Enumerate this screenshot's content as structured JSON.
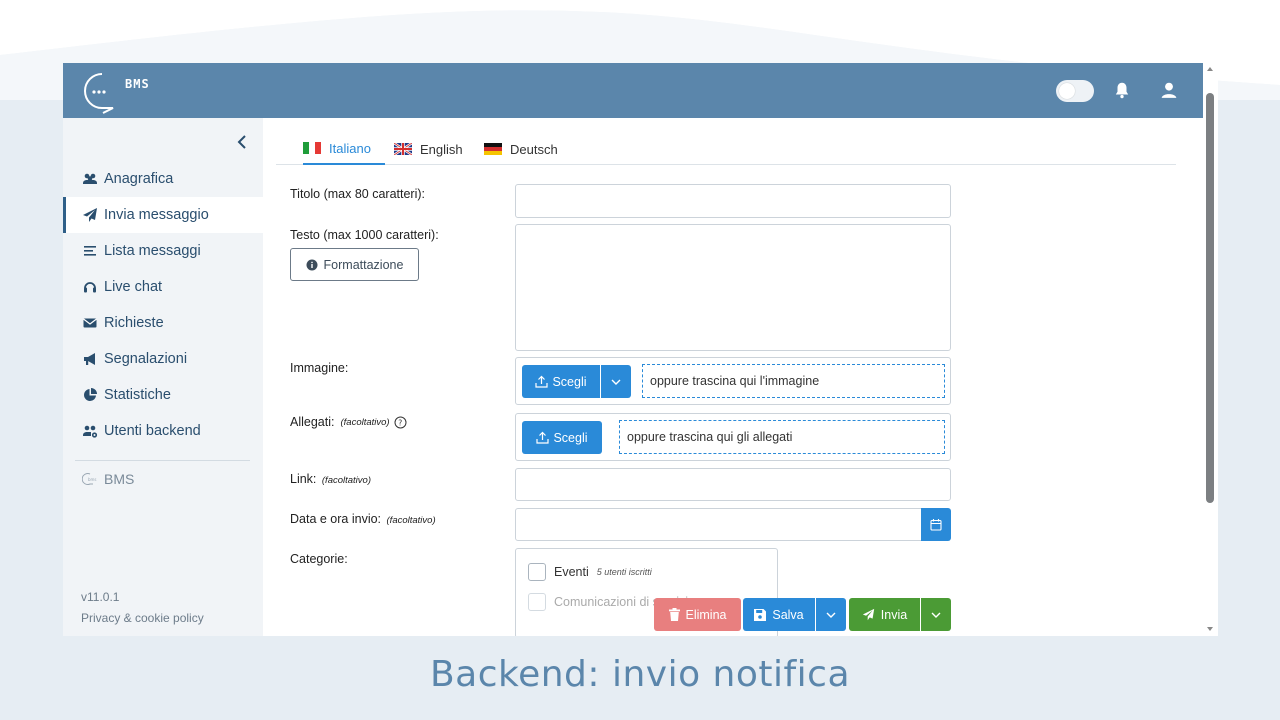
{
  "brand": {
    "logo_text": "BMS"
  },
  "sidebar": {
    "items": [
      {
        "label": "Anagrafica",
        "icon": "users-icon",
        "active": false
      },
      {
        "label": "Invia messaggio",
        "icon": "paper-plane-icon",
        "active": true
      },
      {
        "label": "Lista messaggi",
        "icon": "list-icon",
        "active": false
      },
      {
        "label": "Live chat",
        "icon": "headset-icon",
        "active": false
      },
      {
        "label": "Richieste",
        "icon": "envelope-icon",
        "active": false
      },
      {
        "label": "Segnalazioni",
        "icon": "megaphone-icon",
        "active": false
      },
      {
        "label": "Statistiche",
        "icon": "pie-chart-icon",
        "active": false
      },
      {
        "label": "Utenti backend",
        "icon": "users-gear-icon",
        "active": false
      }
    ],
    "bms_link": "BMS",
    "version": "v11.0.1",
    "privacy": "Privacy & cookie policy"
  },
  "tabs": [
    {
      "label": "Italiano",
      "active": true
    },
    {
      "label": "English",
      "active": false
    },
    {
      "label": "Deutsch",
      "active": false
    }
  ],
  "form": {
    "title_label": "Titolo (max 80 caratteri):",
    "text_label": "Testo (max 1000 caratteri):",
    "format_button": "Formattazione",
    "image_label": "Immagine:",
    "attachments_label": "Allegati:",
    "optional": "(facoltativo)",
    "choose_button": "Scegli",
    "image_drop": "oppure trascina qui l'immagine",
    "attachments_drop": "oppure trascina qui gli allegati",
    "link_label": "Link:",
    "date_label": "Data e ora invio:",
    "categories_label": "Categorie:",
    "categories": [
      {
        "name": "Eventi",
        "count": "5 utenti iscritti"
      },
      {
        "name": "Comunicazioni di servizio",
        "count": ""
      }
    ]
  },
  "actions": {
    "delete": "Elimina",
    "save": "Salva",
    "send": "Invia"
  },
  "caption": "Backend: invio notifica",
  "colors": {
    "header": "#5b86ab",
    "primary": "#2a8ad8",
    "danger": "#e87f7f",
    "success": "#4b9b35"
  }
}
